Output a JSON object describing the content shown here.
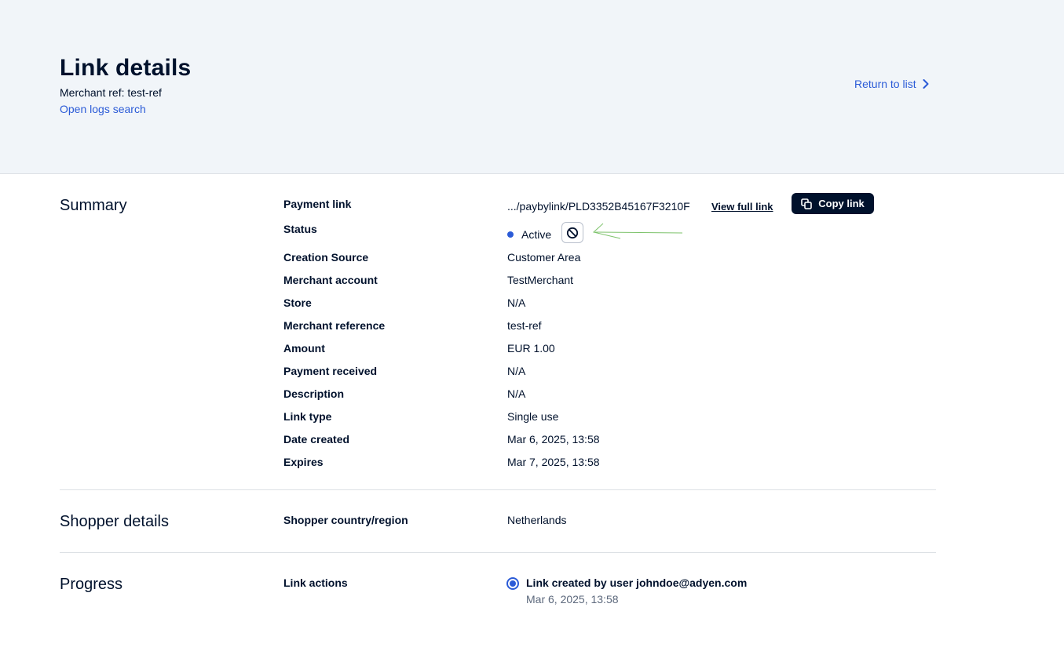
{
  "header": {
    "title": "Link details",
    "merchant_ref": "Merchant ref: test-ref",
    "logs_link": "Open logs search",
    "return_link": "Return to list"
  },
  "summary": {
    "title": "Summary",
    "rows": [
      {
        "label": "Payment link",
        "value": ".../paybylink/PLD3352B45167F3210F"
      },
      {
        "label": "Status",
        "value": "Active"
      },
      {
        "label": "Creation Source",
        "value": "Customer Area"
      },
      {
        "label": "Merchant account",
        "value": "TestMerchant"
      },
      {
        "label": "Store",
        "value": "N/A"
      },
      {
        "label": "Merchant reference",
        "value": "test-ref"
      },
      {
        "label": "Amount",
        "value": "EUR 1.00"
      },
      {
        "label": "Payment received",
        "value": "N/A"
      },
      {
        "label": "Description",
        "value": "N/A"
      },
      {
        "label": "Link type",
        "value": "Single use"
      },
      {
        "label": "Date created",
        "value": "Mar 6, 2025, 13:58"
      },
      {
        "label": "Expires",
        "value": "Mar 7, 2025, 13:58"
      }
    ],
    "view_full_link": "View full link",
    "copy_link": "Copy link",
    "status_color": "#2b5bd7"
  },
  "shopper": {
    "title": "Shopper details",
    "rows": [
      {
        "label": "Shopper country/region",
        "value": "Netherlands"
      }
    ]
  },
  "progress": {
    "title": "Progress",
    "label": "Link actions",
    "event_title": "Link created by user johndoe@adyen.com",
    "event_date": "Mar 6, 2025, 13:58"
  },
  "icons": {
    "copy": "copy-icon",
    "deactivate": "block-icon",
    "return": "chevron-right-icon"
  },
  "colors": {
    "accent": "#2b5bd7",
    "text": "#00112c",
    "header_bg": "#f1f5f9",
    "annotation": "#7cc26a"
  }
}
